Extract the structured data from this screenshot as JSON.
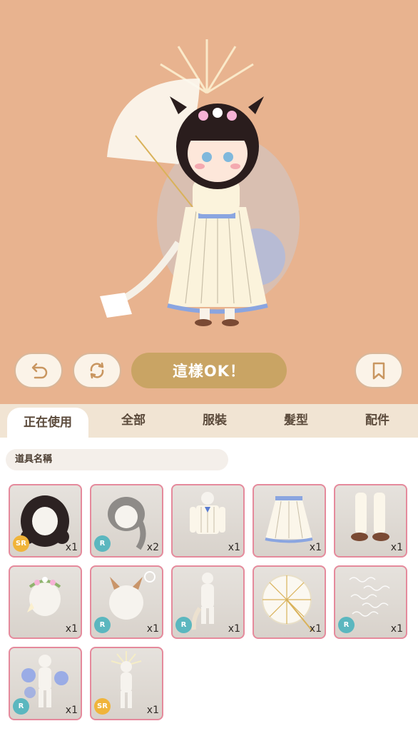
{
  "controls": {
    "ok_label": "這樣OK！"
  },
  "tabs": [
    {
      "label": "正在使用",
      "active": true
    },
    {
      "label": "全部",
      "active": false
    },
    {
      "label": "服裝",
      "active": false
    },
    {
      "label": "髮型",
      "active": false
    },
    {
      "label": "配件",
      "active": false
    }
  ],
  "search": {
    "placeholder": "道具名稱"
  },
  "items": [
    {
      "name": "hair-dark-curly",
      "rarity": "SR",
      "qty": "x1"
    },
    {
      "name": "hair-gray-braid",
      "rarity": "R",
      "qty": "x2"
    },
    {
      "name": "striped-shirt",
      "rarity": "",
      "qty": "x1"
    },
    {
      "name": "striped-skirt",
      "rarity": "",
      "qty": "x1"
    },
    {
      "name": "socks-shoes",
      "rarity": "",
      "qty": "x1"
    },
    {
      "name": "flower-crown",
      "rarity": "",
      "qty": "x1"
    },
    {
      "name": "horns",
      "rarity": "R",
      "qty": "x1"
    },
    {
      "name": "tail",
      "rarity": "R",
      "qty": "x1"
    },
    {
      "name": "lace-umbrella",
      "rarity": "",
      "qty": "x1"
    },
    {
      "name": "script-effect",
      "rarity": "R",
      "qty": "x1"
    },
    {
      "name": "blue-aura-effect",
      "rarity": "R",
      "qty": "x1"
    },
    {
      "name": "halo-effect",
      "rarity": "SR",
      "qty": "x1"
    }
  ],
  "colors": {
    "stage_bg": "#e8b38f",
    "ok_button": "#c9a464",
    "item_border": "#e58a9c",
    "rarity_R": "#5bb7bf",
    "rarity_SR": "#f0b43a"
  }
}
